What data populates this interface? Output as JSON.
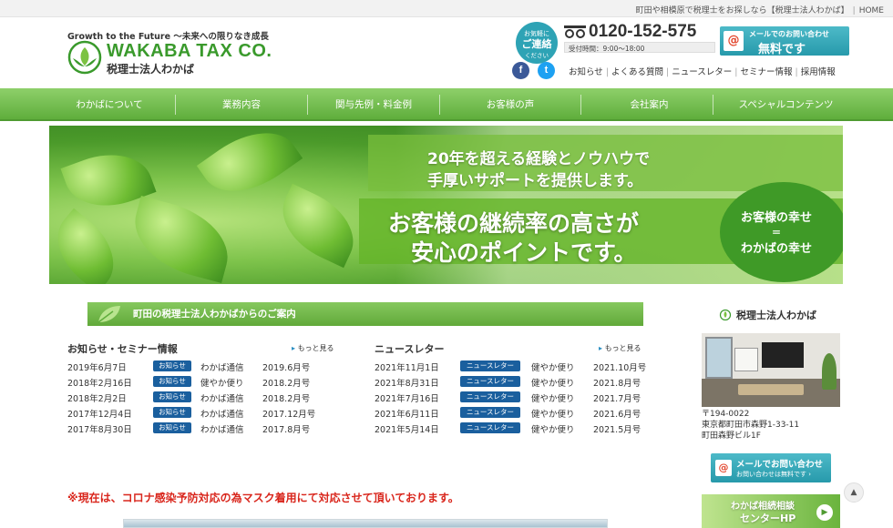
{
  "topbar": {
    "text": "町田や相模原で税理士をお探しなら【税理士法人わかば】",
    "home": "HOME"
  },
  "header": {
    "tagline": "Growth to the Future ～未来への限りなき成長",
    "logo_en": "WAKABA TAX CO.",
    "logo_ja": "税理士法人わかば",
    "bubble": {
      "l1": "お気軽に",
      "l2": "ご連絡",
      "l3": "ください"
    },
    "phone": "0120-152-575",
    "hours": "受付時間：9:00～18:00",
    "mail_btn": {
      "line1": "メールでのお問い合わせ",
      "line2": "無料です"
    },
    "social": {
      "facebook": "f",
      "twitter": "t"
    },
    "links": [
      "お知らせ",
      "よくある質問",
      "ニュースレター",
      "セミナー情報",
      "採用情報"
    ]
  },
  "nav": [
    "わかばについて",
    "業務内容",
    "関与先例・料金例",
    "お客様の声",
    "会社案内",
    "スペシャルコンテンツ"
  ],
  "hero": {
    "sub1": "20年を超える経験とノウハウで",
    "sub2": "手厚いサポートを提供します。",
    "main1": "お客様の継続率の高さが",
    "main2": "安心のポイントです。",
    "circle1": "お客様の幸せ",
    "circle2": "＝",
    "circle3": "わかばの幸せ"
  },
  "intro": "町田の税理士法人わかばからのご案内",
  "news": {
    "title": "お知らせ・セミナー情報",
    "more": "もっと見る",
    "items": [
      {
        "date": "2019年6月7日",
        "badge": "お知らせ",
        "kind": "わかば通信",
        "title": "2019.6月号"
      },
      {
        "date": "2018年2月16日",
        "badge": "お知らせ",
        "kind": "健やか便り",
        "title": "2018.2月号"
      },
      {
        "date": "2018年2月2日",
        "badge": "お知らせ",
        "kind": "わかば通信",
        "title": "2018.2月号"
      },
      {
        "date": "2017年12月4日",
        "badge": "お知らせ",
        "kind": "わかば通信",
        "title": "2017.12月号"
      },
      {
        "date": "2017年8月30日",
        "badge": "お知らせ",
        "kind": "わかば通信",
        "title": "2017.8月号"
      }
    ]
  },
  "letters": {
    "title": "ニュースレター",
    "more": "もっと見る",
    "items": [
      {
        "date": "2021年11月1日",
        "badge": "ニュースレター",
        "kind": "健やか便り",
        "title": "2021.10月号"
      },
      {
        "date": "2021年8月31日",
        "badge": "ニュースレター",
        "kind": "健やか便り",
        "title": "2021.8月号"
      },
      {
        "date": "2021年7月16日",
        "badge": "ニュースレター",
        "kind": "健やか便り",
        "title": "2021.7月号"
      },
      {
        "date": "2021年6月11日",
        "badge": "ニュースレター",
        "kind": "健やか便り",
        "title": "2021.6月号"
      },
      {
        "date": "2021年5月14日",
        "badge": "ニュースレター",
        "kind": "健やか便り",
        "title": "2021.5月号"
      }
    ]
  },
  "notice": "※現在は、コロナ感染予防対応の為マスク着用にて対応させて頂いております。",
  "sidebar": {
    "title": "税理士法人わかば",
    "zip": "〒194-0022",
    "addr1": "東京都町田市森野1-33-11",
    "addr2": "町田森野ビル1F",
    "mail": {
      "line1": "メールでお問い合わせ",
      "line2": "お問い合わせは無料です ›"
    },
    "inherit": {
      "line1": "わかば相続相談",
      "line2": "センターHP"
    }
  },
  "colors": {
    "brand_green": "#5fae3c",
    "badge_blue": "#1a5f9e",
    "notice_red": "#d9261c",
    "accent_teal": "#279aab"
  }
}
